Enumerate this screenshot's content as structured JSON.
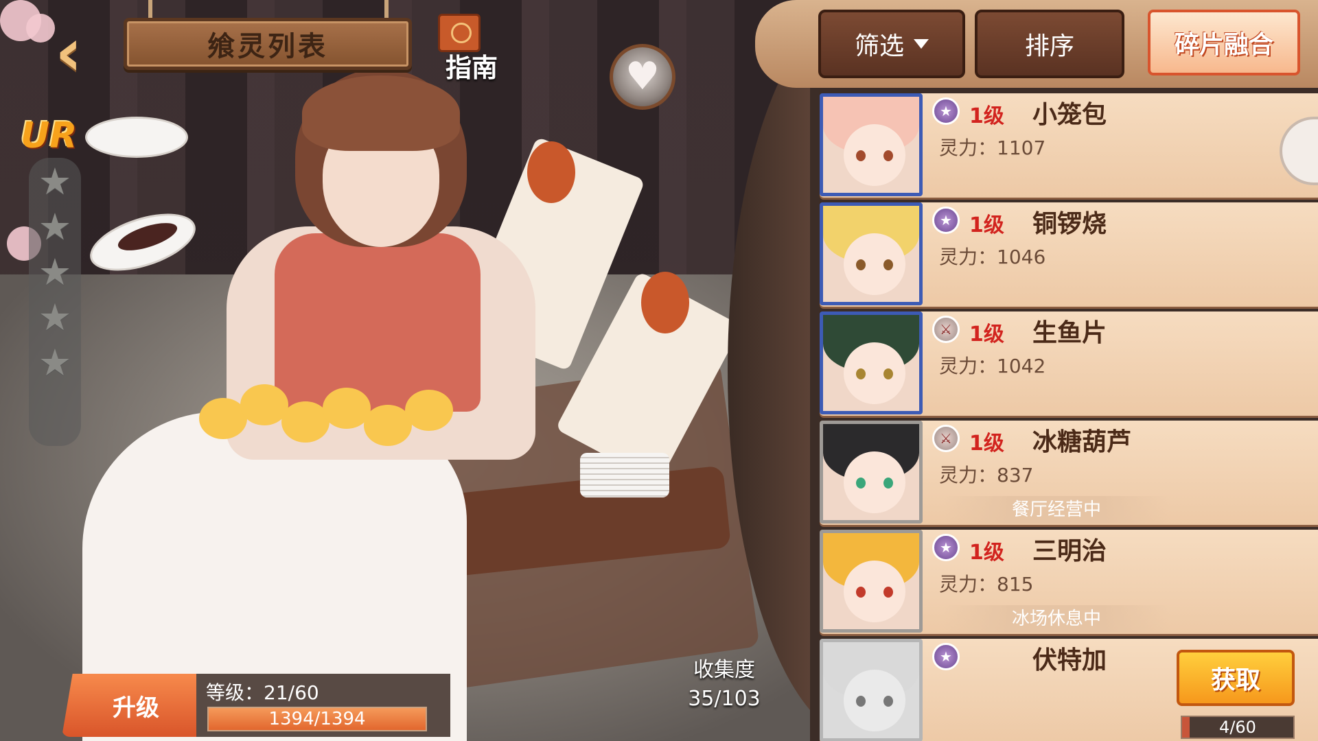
{
  "header": {
    "title": "飨灵列表",
    "guide_label": "指南"
  },
  "hero": {
    "rarity": "UR",
    "stars_max": 5,
    "level_text": "等级：21/60",
    "exp_text": "1394/1394",
    "exp_progress": 1.0,
    "upgrade_label": "升级"
  },
  "collection": {
    "label": "收集度",
    "value": "35/103"
  },
  "toolbar": {
    "filter_label": "筛选",
    "sort_label": "排序",
    "fuse_label": "碎片融合"
  },
  "cards": [
    {
      "name": "小笼包",
      "level": "1级",
      "power": "灵力：1107",
      "type_icon": "star-icon",
      "status": ""
    },
    {
      "name": "铜锣烧",
      "level": "1级",
      "power": "灵力：1046",
      "type_icon": "star-icon",
      "status": ""
    },
    {
      "name": "生鱼片",
      "level": "1级",
      "power": "灵力：1042",
      "type_icon": "sword-icon",
      "status": ""
    },
    {
      "name": "冰糖葫芦",
      "level": "1级",
      "power": "灵力：837",
      "type_icon": "sword-icon",
      "status": "餐厅经营中"
    },
    {
      "name": "三明治",
      "level": "1级",
      "power": "灵力：815",
      "type_icon": "star-icon",
      "status": "冰场休息中"
    },
    {
      "name": "伏特加",
      "get_label": "获取",
      "fragments": "4/60",
      "fragment_progress": 0.0667,
      "type_icon": "star-icon"
    }
  ],
  "colors": {
    "accent": "#d9552a",
    "level_red": "#d2231e",
    "panel": "#3c2d27"
  }
}
